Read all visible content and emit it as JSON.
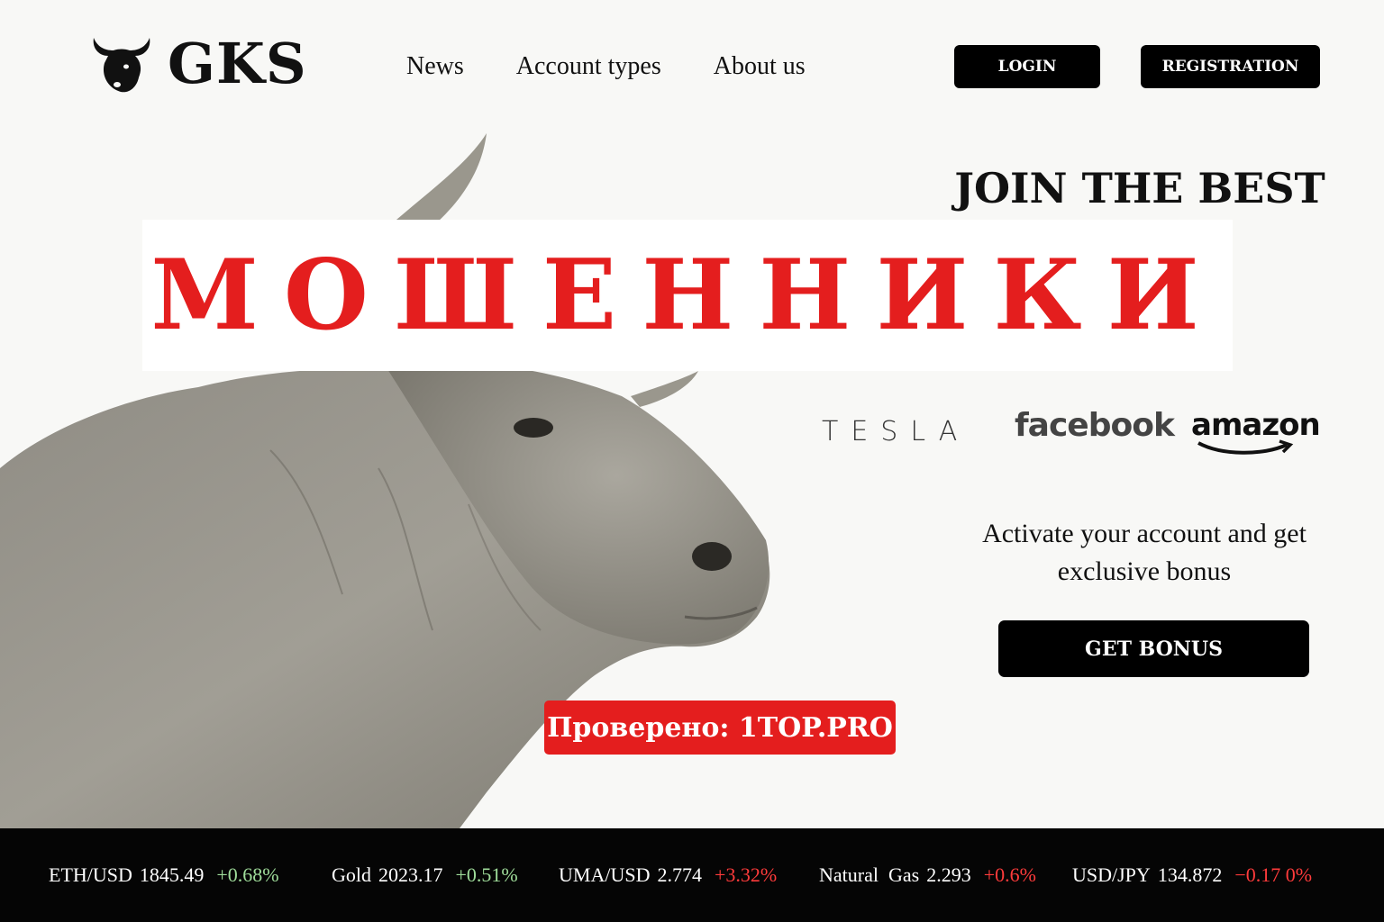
{
  "header": {
    "logo_text": "GKS",
    "nav": [
      "News",
      "Account types",
      "About us"
    ],
    "login_label": "LOGIN",
    "registration_label": "REGISTRATION"
  },
  "hero": {
    "title": "JOIN THE BEST",
    "fraud_label": "МОШЕННИКИ",
    "brands": {
      "tesla": "TESLA",
      "facebook": "facebook",
      "amazon": "amazon"
    },
    "promo_line1": "Activate your account and get",
    "promo_line2": "exclusive bonus",
    "bonus_button": "GET BONUS",
    "verified_label": "Проверено: 1TOP.PRO"
  },
  "ticker": [
    {
      "symbol": "ETH/USD",
      "price": "1845.49",
      "change": "+0.68%",
      "color": "#9fdc9a"
    },
    {
      "symbol": "Gold",
      "price": "2023.17",
      "change": "+0.51%",
      "color": "#9fdc9a"
    },
    {
      "symbol": "UMA/USD",
      "price": "2.774",
      "change": "+3.32%",
      "color": "#ff3b3b"
    },
    {
      "symbol": "Natural  Gas",
      "price": "2.293",
      "change": "+0.6%",
      "color": "#ff3b3b"
    },
    {
      "symbol": "USD/JPY",
      "price": "134.872",
      "change": "−0.17 0%",
      "color": "#ff3b3b"
    }
  ],
  "colors": {
    "accent_red": "#e41e1e",
    "black": "#000000",
    "background": "#f8f8f6"
  }
}
